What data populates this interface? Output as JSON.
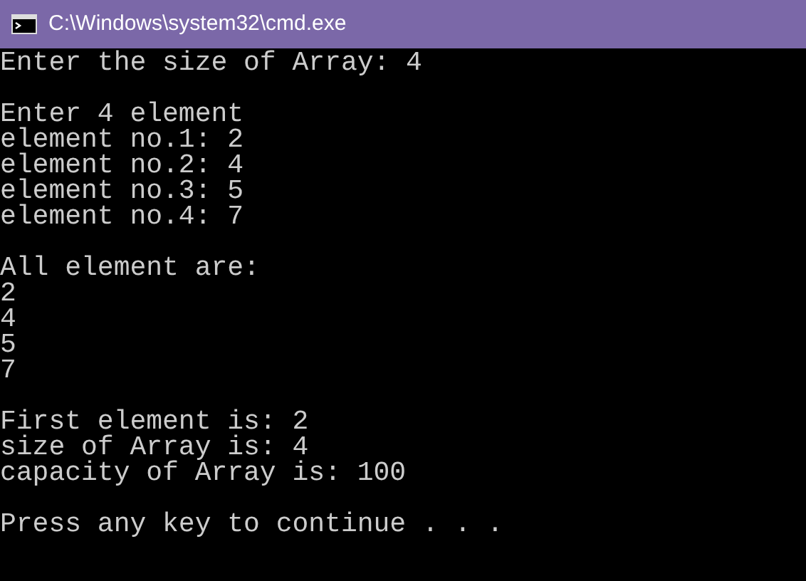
{
  "window": {
    "title": "C:\\Windows\\system32\\cmd.exe"
  },
  "console": {
    "blocks": [
      [
        "Enter the size of Array: 4"
      ],
      [
        "Enter 4 element",
        "element no.1: 2",
        "element no.2: 4",
        "element no.3: 5",
        "element no.4: 7"
      ],
      [
        "All element are:",
        "2",
        "4",
        "5",
        "7"
      ],
      [
        "First element is: 2",
        "size of Array is: 4",
        "capacity of Array is: 100"
      ],
      [
        "Press any key to continue . . ."
      ]
    ]
  }
}
